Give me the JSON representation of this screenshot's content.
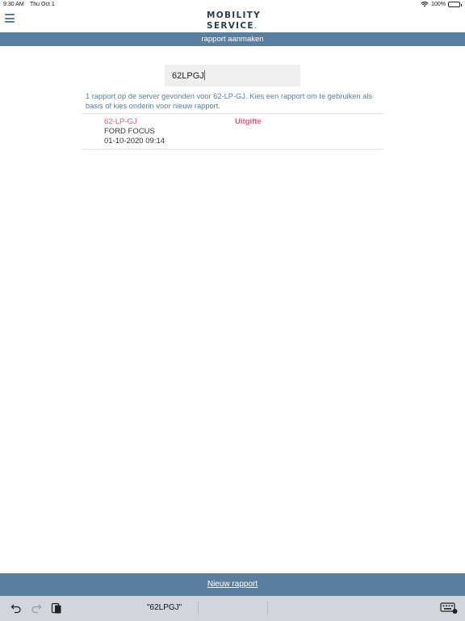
{
  "status": {
    "time": "9:30 AM",
    "date": "Thu Oct 1",
    "battery": "100%"
  },
  "header": {
    "logo_line1": "MOBILITY",
    "logo_line2": "SERVICE",
    "title": "rapport aanmaken"
  },
  "search": {
    "value": "62LPGJ"
  },
  "info_text": "1 rapport op de server gevonden voor 62-LP-GJ. Kies een rapport om te gebruiken als basis of kies onderin voor nieuw rapport.",
  "results": [
    {
      "plate": "62-LP-GJ",
      "type": "Uitgifte",
      "car": "FORD FOCUS",
      "datetime": "01-10-2020 09:14"
    }
  ],
  "footer": {
    "new_report": "Nieuw rapport"
  },
  "keyboard": {
    "suggestion": "\"62LPGJ\""
  },
  "colors": {
    "accent": "#5b7e9e",
    "highlight": "#e0607c"
  }
}
